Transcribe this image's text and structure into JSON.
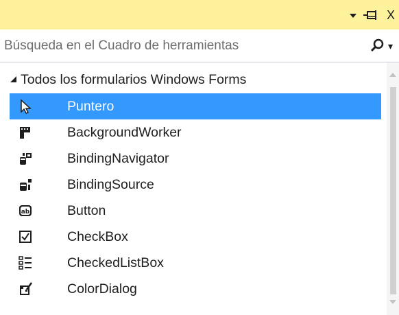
{
  "window": {
    "dropdown_icon": "dropdown-arrow-icon",
    "pin_icon": "pin-icon",
    "close_label": "X"
  },
  "search": {
    "placeholder": "Búsqueda en el Cuadro de herramientas",
    "icon": "search-icon"
  },
  "group": {
    "label": "Todos los formularios Windows Forms",
    "expanded": true
  },
  "items": [
    {
      "label": "Puntero",
      "icon": "pointer-icon",
      "selected": true
    },
    {
      "label": "BackgroundWorker",
      "icon": "background-worker-icon",
      "selected": false
    },
    {
      "label": "BindingNavigator",
      "icon": "binding-navigator-icon",
      "selected": false
    },
    {
      "label": "BindingSource",
      "icon": "binding-source-icon",
      "selected": false
    },
    {
      "label": "Button",
      "icon": "button-icon",
      "selected": false
    },
    {
      "label": "CheckBox",
      "icon": "checkbox-icon",
      "selected": false
    },
    {
      "label": "CheckedListBox",
      "icon": "checked-list-box-icon",
      "selected": false
    },
    {
      "label": "ColorDialog",
      "icon": "color-dialog-icon",
      "selected": false
    }
  ],
  "colors": {
    "titlebar": "#fff29d",
    "selection": "#3399ff"
  }
}
